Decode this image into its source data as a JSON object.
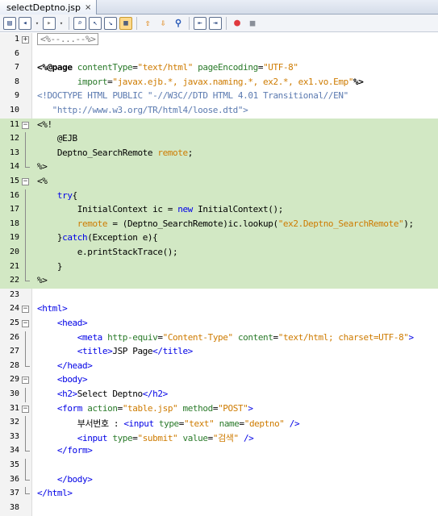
{
  "tab": {
    "filename": "selectDeptno.jsp",
    "close": "×"
  },
  "toolbar": {
    "icons": [
      "source-history-icon",
      "back-icon",
      "forward-icon",
      "find-icon",
      "find-prev-icon",
      "find-next-icon",
      "toggle-highlight-icon",
      "prev-bookmark-icon",
      "next-bookmark-icon",
      "toggle-bookmark-icon",
      "shift-left-icon",
      "shift-right-icon",
      "record-macro-icon",
      "stop-macro-icon"
    ]
  },
  "editor": {
    "lines": [
      {
        "n": "1",
        "fold": "plus",
        "segs": [
          {
            "c": "collapsed",
            "t": "<%--...--%>"
          }
        ]
      },
      {
        "n": "6",
        "segs": []
      },
      {
        "n": "7",
        "segs": [
          {
            "c": "k",
            "t": "<%@page"
          },
          {
            "c": "g",
            "t": " contentType"
          },
          {
            "c": "",
            "t": "="
          },
          {
            "c": "o",
            "t": "\"text/html\""
          },
          {
            "c": "g",
            "t": " pageEncoding"
          },
          {
            "c": "",
            "t": "="
          },
          {
            "c": "o",
            "t": "\"UTF-8\""
          }
        ]
      },
      {
        "n": "8",
        "segs": [
          {
            "c": "g",
            "t": "        import"
          },
          {
            "c": "",
            "t": "="
          },
          {
            "c": "o",
            "t": "\"javax.ejb.*, javax.naming.*, ex2.*, ex1.vo.Emp\""
          },
          {
            "c": "k",
            "t": "%>"
          }
        ]
      },
      {
        "n": "9",
        "segs": [
          {
            "c": "dt",
            "t": "<!DOCTYPE HTML PUBLIC \"-//W3C//DTD HTML 4.01 Transitional//EN\""
          }
        ]
      },
      {
        "n": "10",
        "segs": [
          {
            "c": "dt",
            "t": "   \"http://www.w3.org/TR/html4/loose.dtd\">"
          }
        ]
      },
      {
        "n": "11",
        "hl": true,
        "fold": "minus",
        "segs": [
          {
            "c": "",
            "t": "<%!"
          }
        ]
      },
      {
        "n": "12",
        "hl": true,
        "foldline": true,
        "segs": [
          {
            "c": "",
            "t": "    @EJB"
          }
        ]
      },
      {
        "n": "13",
        "hl": true,
        "foldline": true,
        "segs": [
          {
            "c": "",
            "t": "    Deptno_SearchRemote "
          },
          {
            "c": "v",
            "t": "remote"
          },
          {
            "c": "",
            "t": ";"
          }
        ]
      },
      {
        "n": "14",
        "hl": true,
        "fold": "end",
        "segs": [
          {
            "c": "",
            "t": "%>"
          }
        ]
      },
      {
        "n": "15",
        "hl": true,
        "fold": "minus",
        "segs": [
          {
            "c": "",
            "t": "<%"
          }
        ]
      },
      {
        "n": "16",
        "hl": true,
        "foldline": true,
        "segs": [
          {
            "c": "b",
            "t": "    try"
          },
          {
            "c": "",
            "t": "{"
          }
        ]
      },
      {
        "n": "17",
        "hl": true,
        "foldline": true,
        "segs": [
          {
            "c": "",
            "t": "        InitialContext ic = "
          },
          {
            "c": "b",
            "t": "new"
          },
          {
            "c": "",
            "t": " InitialContext();"
          }
        ]
      },
      {
        "n": "18",
        "hl": true,
        "foldline": true,
        "segs": [
          {
            "c": "v",
            "t": "        remote"
          },
          {
            "c": "",
            "t": " = (Deptno_SearchRemote)ic.lookup("
          },
          {
            "c": "o",
            "t": "\"ex2.Deptno_SearchRemote\""
          },
          {
            "c": "",
            "t": ");"
          }
        ]
      },
      {
        "n": "19",
        "hl": true,
        "foldline": true,
        "segs": [
          {
            "c": "",
            "t": "    }"
          },
          {
            "c": "b",
            "t": "catch"
          },
          {
            "c": "",
            "t": "(Exception e){"
          }
        ]
      },
      {
        "n": "20",
        "hl": true,
        "foldline": true,
        "segs": [
          {
            "c": "",
            "t": "        e.printStackTrace();"
          }
        ]
      },
      {
        "n": "21",
        "hl": true,
        "foldline": true,
        "segs": [
          {
            "c": "",
            "t": "    }"
          }
        ]
      },
      {
        "n": "22",
        "hl": true,
        "fold": "end",
        "segs": [
          {
            "c": "",
            "t": "%>"
          }
        ]
      },
      {
        "n": "23",
        "segs": []
      },
      {
        "n": "24",
        "fold": "minus",
        "segs": [
          {
            "c": "t",
            "t": "<html>"
          }
        ]
      },
      {
        "n": "25",
        "fold": "minus",
        "segs": [
          {
            "c": "t",
            "t": "    <head>"
          }
        ]
      },
      {
        "n": "26",
        "foldline": true,
        "segs": [
          {
            "c": "t",
            "t": "        <meta"
          },
          {
            "c": "a",
            "t": " http-equiv"
          },
          {
            "c": "",
            "t": "="
          },
          {
            "c": "o",
            "t": "\"Content-Type\""
          },
          {
            "c": "a",
            "t": " content"
          },
          {
            "c": "",
            "t": "="
          },
          {
            "c": "o",
            "t": "\"text/html; charset=UTF-8\""
          },
          {
            "c": "t",
            "t": ">"
          }
        ]
      },
      {
        "n": "27",
        "foldline": true,
        "segs": [
          {
            "c": "t",
            "t": "        <title>"
          },
          {
            "c": "",
            "t": "JSP Page"
          },
          {
            "c": "t",
            "t": "</title>"
          }
        ]
      },
      {
        "n": "28",
        "fold": "end",
        "segs": [
          {
            "c": "t",
            "t": "    </head>"
          }
        ]
      },
      {
        "n": "29",
        "fold": "minus",
        "segs": [
          {
            "c": "t",
            "t": "    <body>"
          }
        ]
      },
      {
        "n": "30",
        "foldline": true,
        "segs": [
          {
            "c": "t",
            "t": "    <h2>"
          },
          {
            "c": "",
            "t": "Select Deptno"
          },
          {
            "c": "t",
            "t": "</h2>"
          }
        ]
      },
      {
        "n": "31",
        "fold": "minus",
        "segs": [
          {
            "c": "t",
            "t": "    <form"
          },
          {
            "c": "a",
            "t": " action"
          },
          {
            "c": "",
            "t": "="
          },
          {
            "c": "o",
            "t": "\"table.jsp\""
          },
          {
            "c": "a",
            "t": " method"
          },
          {
            "c": "",
            "t": "="
          },
          {
            "c": "o",
            "t": "\"POST\""
          },
          {
            "c": "t",
            "t": ">"
          }
        ]
      },
      {
        "n": "32",
        "foldline": true,
        "segs": [
          {
            "c": "",
            "t": "        부서번호 : "
          },
          {
            "c": "t",
            "t": "<input"
          },
          {
            "c": "a",
            "t": " type"
          },
          {
            "c": "",
            "t": "="
          },
          {
            "c": "o",
            "t": "\"text\""
          },
          {
            "c": "a",
            "t": " name"
          },
          {
            "c": "",
            "t": "="
          },
          {
            "c": "o",
            "t": "\"deptno\""
          },
          {
            "c": "t",
            "t": " />"
          }
        ]
      },
      {
        "n": "33",
        "foldline": true,
        "segs": [
          {
            "c": "t",
            "t": "        <input"
          },
          {
            "c": "a",
            "t": " type"
          },
          {
            "c": "",
            "t": "="
          },
          {
            "c": "o",
            "t": "\"submit\""
          },
          {
            "c": "a",
            "t": " value"
          },
          {
            "c": "",
            "t": "="
          },
          {
            "c": "o",
            "t": "\"검색\""
          },
          {
            "c": "t",
            "t": " />"
          }
        ]
      },
      {
        "n": "34",
        "fold": "end",
        "segs": [
          {
            "c": "t",
            "t": "    </form>"
          }
        ]
      },
      {
        "n": "35",
        "foldline": true,
        "segs": []
      },
      {
        "n": "36",
        "fold": "end",
        "segs": [
          {
            "c": "t",
            "t": "    </body>"
          }
        ]
      },
      {
        "n": "37",
        "fold": "end",
        "segs": [
          {
            "c": "t",
            "t": "</html>"
          }
        ]
      },
      {
        "n": "38",
        "segs": []
      }
    ]
  }
}
